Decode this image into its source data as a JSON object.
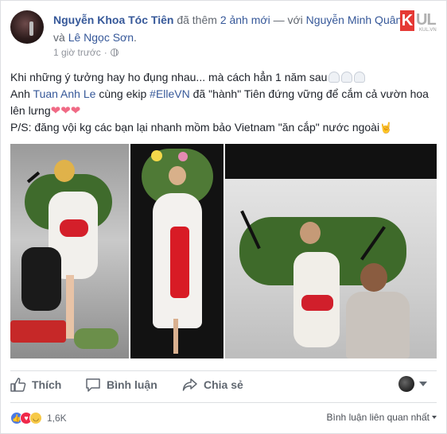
{
  "post": {
    "author": "Nguyễn Khoa Tóc Tiên",
    "action_text": " đã thêm ",
    "photo_count_link": "2 ảnh mới",
    "with_text": " — với ",
    "tagged_1": "Nguyễn Minh Quân",
    "and_text": " và ",
    "tagged_2": "Lê Ngọc Sơn",
    "period": ".",
    "timestamp": "1 giờ trước",
    "audience_icon": "globe-icon"
  },
  "watermark": {
    "letter": "K",
    "rest": "UL",
    "sub": "KUL.VN"
  },
  "body": {
    "line1": "Khi những ý tưởng hay ho đụng nhau... mà cách hẳn 1 năm sau",
    "line2_pre": "Anh ",
    "line2_link1": "Tuan Anh Le",
    "line2_mid": " cùng ekip ",
    "line2_link2": "#ElleVN",
    "line2_post": " đã \"hành\" Tiên đứng vững để cắm cả vườn hoa lên lưng",
    "hearts": "❤❤❤",
    "line3": "P/S: đăng vội kg các bạn lại nhanh mồm bảo Vietnam \"ăn cắp\" nước ngoài",
    "hand": "🤘"
  },
  "actions": {
    "like": "Thích",
    "comment": "Bình luận",
    "share": "Chia sẻ"
  },
  "footer": {
    "reaction_count": "1,6K",
    "sort_label": "Bình luận liên quan nhất"
  },
  "colors": {
    "link": "#365899",
    "like_blue": "#4b7be5",
    "love_red": "#f0284a",
    "haha_yellow": "#f7c948"
  }
}
